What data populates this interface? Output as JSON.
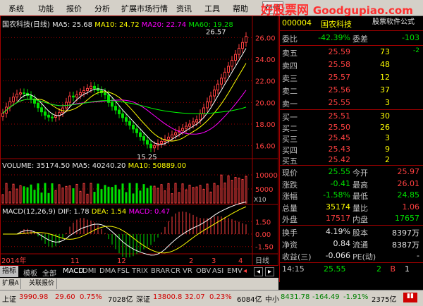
{
  "menu": [
    "系统",
    "功能",
    "报价",
    "分析",
    "扩展市场行情",
    "资讯",
    "工具",
    "帮助",
    "行情"
  ],
  "logo": {
    "cn": "好股票网",
    "domain": "Goodgupiao.com",
    "sub": "股票软件公式"
  },
  "kline": {
    "title": "国农科技(日线)",
    "ma5": "MA5: 25.68",
    "ma10": "MA10: 24.72",
    "ma20": "MA20: 22.74",
    "ma60": "MA60: 19.28",
    "high_label": "26.57",
    "low_label": "15.25",
    "yticks": [
      "26.00",
      "24.00",
      "22.00",
      "20.00",
      "18.00",
      "16.00"
    ]
  },
  "volume": {
    "label": "VOLUME: 35174.50",
    "ma5": "MA5: 40240.20",
    "ma10": "MA10: 50889.00",
    "yticks": [
      "10000",
      "5000"
    ],
    "unit": "X10"
  },
  "macd": {
    "label": "MACD(12,26,9)",
    "dif": "DIF: 1.78",
    "dea": "DEA: 1.54",
    "macd": "MACD: 0.47",
    "yticks": [
      "1.50",
      "0.00",
      "-1.50"
    ]
  },
  "dates": {
    "d1": "2014年",
    "d2": "11",
    "d3": "12",
    "d4": "2",
    "d5": "3",
    "d6": "4",
    "period": "日线"
  },
  "tabs": [
    "指标",
    "模板",
    "全部",
    "MACD",
    "DMI",
    "DMA",
    "FSL",
    "TRIX",
    "BRAR",
    "CR",
    "VR",
    "OBV",
    "ASI",
    "EMV"
  ],
  "bottom_tabs": [
    "扩展A",
    "关联报价"
  ],
  "quote": {
    "code": "000004",
    "name": "国农科技",
    "weibi_label": "委比",
    "weibi": "-42.39%",
    "weicha_label": "委差",
    "weicha": "-103",
    "asks": [
      {
        "l": "卖五",
        "p": "25.59",
        "v": "73",
        "d": "-2"
      },
      {
        "l": "卖四",
        "p": "25.58",
        "v": "48",
        "d": ""
      },
      {
        "l": "卖三",
        "p": "25.57",
        "v": "12",
        "d": ""
      },
      {
        "l": "卖二",
        "p": "25.56",
        "v": "37",
        "d": ""
      },
      {
        "l": "卖一",
        "p": "25.55",
        "v": "3",
        "d": ""
      }
    ],
    "bids": [
      {
        "l": "买一",
        "p": "25.51",
        "v": "30"
      },
      {
        "l": "买二",
        "p": "25.50",
        "v": "26"
      },
      {
        "l": "买三",
        "p": "25.45",
        "v": "3"
      },
      {
        "l": "买四",
        "p": "25.43",
        "v": "9"
      },
      {
        "l": "买五",
        "p": "25.42",
        "v": "2"
      }
    ],
    "stats": [
      {
        "l1": "现价",
        "v1": "25.55",
        "c1": "green",
        "l2": "今开",
        "v2": "25.97",
        "c2": "red"
      },
      {
        "l1": "涨跌",
        "v1": "-0.41",
        "c1": "green",
        "l2": "最高",
        "v2": "26.01",
        "c2": "red"
      },
      {
        "l1": "涨幅",
        "v1": "-1.58%",
        "c1": "green",
        "l2": "最低",
        "v2": "24.85",
        "c2": "green"
      },
      {
        "l1": "总量",
        "v1": "35174",
        "c1": "yellow",
        "l2": "量比",
        "v2": "1.06",
        "c2": "red"
      },
      {
        "l1": "外盘",
        "v1": "17517",
        "c1": "red",
        "l2": "内盘",
        "v2": "17657",
        "c2": "green"
      }
    ],
    "stats2": [
      {
        "l1": "换手",
        "v1": "4.19%",
        "l2": "股本",
        "v2": "8397万"
      },
      {
        "l1": "净资",
        "v1": "0.84",
        "l2": "流通",
        "v2": "8387万"
      },
      {
        "l1": "收益(三)",
        "v1": "-0.066",
        "l2": "PE(动)",
        "v2": "-"
      }
    ],
    "tick": {
      "time": "14:15",
      "price": "25.55",
      "vol": "2",
      "flag": "B",
      "n": "1"
    }
  },
  "status": {
    "sh_label": "上证",
    "sh": "3990.98",
    "sh_chg": "29.60",
    "sh_pct": "0.75%",
    "sh_amt": "7028亿",
    "sz_label": "深证",
    "sz": "13800.8",
    "sz_chg": "32.07",
    "sz_pct": "0.23%",
    "sz_amt": "6084亿",
    "zx_label": "中小",
    "zx": "8431.78",
    "zx_chg": "-164.49",
    "zx_pct": "-1.91%",
    "zx_amt": "2375亿"
  },
  "colors": {
    "up": "#ff4040",
    "down": "#00e000",
    "ma5": "#ffffff",
    "ma10": "#ffff00",
    "ma20": "#ff00ff",
    "ma60": "#00ff00",
    "grid": "#a00000"
  }
}
